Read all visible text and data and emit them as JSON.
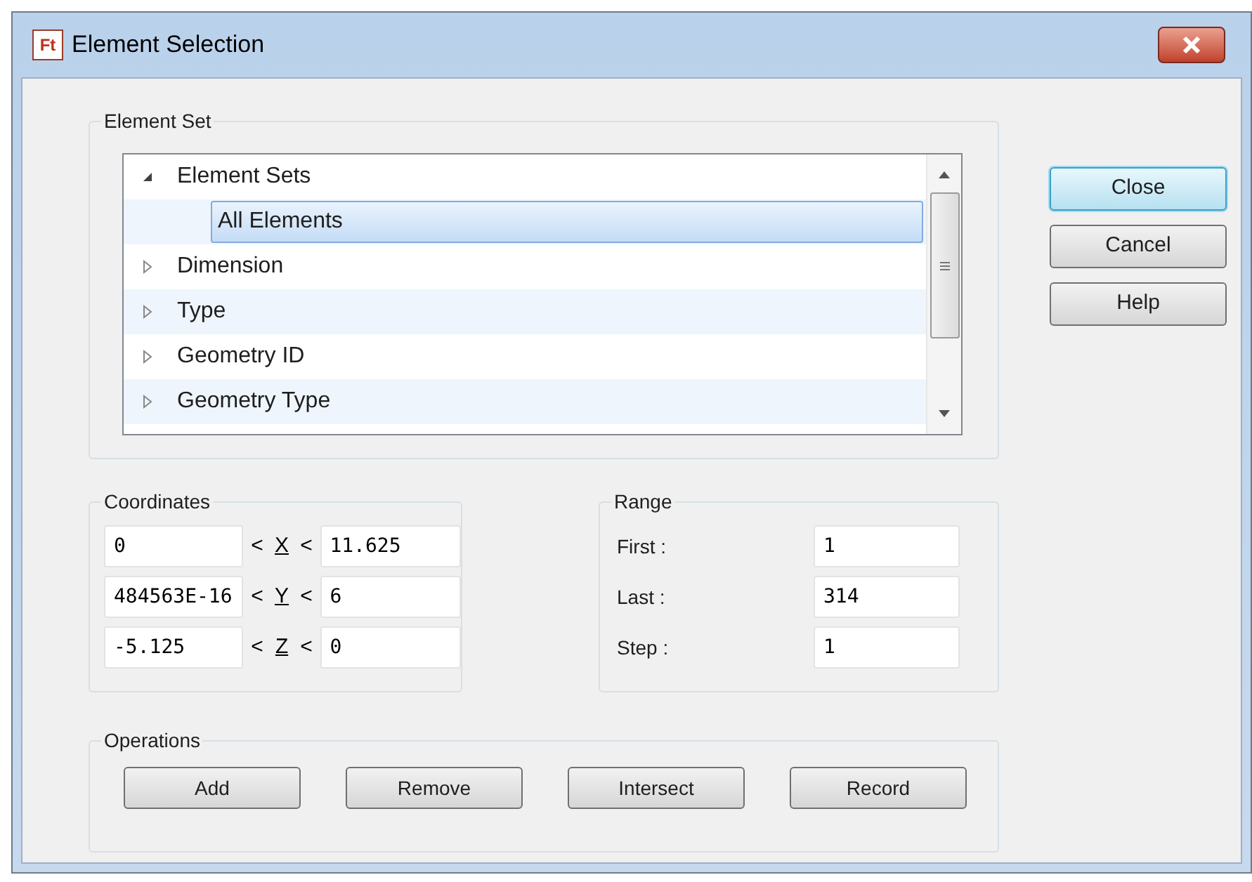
{
  "window": {
    "title": "Element Selection",
    "app_icon": "Ft"
  },
  "element_set": {
    "title": "Element Set",
    "tree": [
      {
        "label": "Element Sets",
        "expanded": true,
        "selected": false,
        "children": [
          {
            "label": "All Elements",
            "selected": true
          }
        ]
      },
      {
        "label": "Dimension",
        "expanded": false,
        "selected": false
      },
      {
        "label": "Type",
        "expanded": false,
        "selected": false
      },
      {
        "label": "Geometry ID",
        "expanded": false,
        "selected": false
      },
      {
        "label": "Geometry Type",
        "expanded": false,
        "selected": false
      }
    ]
  },
  "side_buttons": [
    {
      "label": "Close",
      "default": true
    },
    {
      "label": "Cancel",
      "default": false
    },
    {
      "label": "Help",
      "default": false
    }
  ],
  "coordinates": {
    "title": "Coordinates",
    "rows": [
      {
        "min": "0",
        "axis": "X",
        "max": "11.625",
        "lt": "<"
      },
      {
        "min": "484563E-16",
        "axis": "Y",
        "max": "6",
        "lt": "<"
      },
      {
        "min": "-5.125",
        "axis": "Z",
        "max": "0",
        "lt": "<"
      }
    ]
  },
  "range": {
    "title": "Range",
    "rows": [
      {
        "label": "First :",
        "value": "1"
      },
      {
        "label": "Last :",
        "value": "314"
      },
      {
        "label": "Step :",
        "value": "1"
      }
    ]
  },
  "operations": {
    "title": "Operations",
    "buttons": [
      "Add",
      "Remove",
      "Intersect",
      "Record"
    ]
  }
}
